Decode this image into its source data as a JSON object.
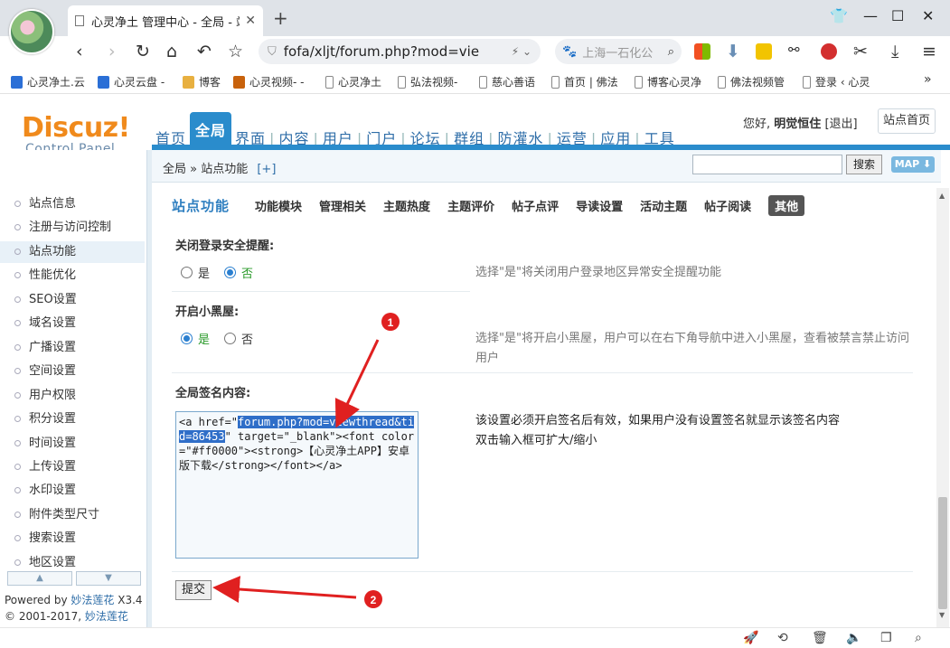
{
  "browser": {
    "tab_title": "心灵净土 管理中心 - 全局 - 站",
    "url": "fofa/xljt/forum.php?mod=vie",
    "search_placeholder": "上海一石化公",
    "bookmarks": [
      "心灵净土.云",
      "心灵云盘 -",
      "博客",
      "心灵视频- -",
      "心灵净土",
      "弘法视频-",
      "慈心善语",
      "首页 | 佛法",
      "博客心灵净",
      "佛法视频管",
      "登录 ‹ 心灵"
    ],
    "bookmarks_more": "»"
  },
  "header": {
    "logo": "Discuz!",
    "logo_sub": "Control Panel",
    "nav": [
      "首页",
      "全局",
      "界面",
      "内容",
      "用户",
      "门户",
      "论坛",
      "群组",
      "防灌水",
      "运营",
      "应用",
      "工具"
    ],
    "hello_prefix": "您好,",
    "username": "明觉恒住",
    "logout": "[退出]",
    "site_home": "站点首页",
    "breadcrumb": "全局 » 站点功能",
    "breadcrumb_plus": "[+]",
    "search_button": "搜索",
    "map_button": "MAP ⬇"
  },
  "sidebar": {
    "items": [
      "站点信息",
      "注册与访问控制",
      "站点功能",
      "性能优化",
      "SEO设置",
      "域名设置",
      "广播设置",
      "空间设置",
      "用户权限",
      "积分设置",
      "时间设置",
      "上传设置",
      "水印设置",
      "附件类型尺寸",
      "搜索设置",
      "地区设置"
    ],
    "arrow_up": "▲",
    "arrow_down": "▼",
    "powered_prefix": "Powered by",
    "powered_link": "妙法莲花",
    "powered_ver": "X3.4",
    "copyright_prefix": "© 2001-2017,",
    "copyright_link": "妙法莲花"
  },
  "content": {
    "section_title": "站点功能",
    "tabs": [
      "功能模块",
      "管理相关",
      "主题热度",
      "主题评价",
      "帖子点评",
      "导读设置",
      "活动主题",
      "帖子阅读",
      "其他"
    ],
    "field1": {
      "label": "关闭登录安全提醒:",
      "opt_yes": "是",
      "opt_no": "否",
      "tip": "选择\"是\"将关闭用户登录地区异常安全提醒功能"
    },
    "field2": {
      "label": "开启小黑屋:",
      "opt_yes": "是",
      "opt_no": "否",
      "tip": "选择\"是\"将开启小黑屋，用户可以在右下角导航中进入小黑屋，查看被禁言禁止访问用户"
    },
    "field3": {
      "label": "全局签名内容:",
      "value_before": "<a href=\"",
      "value_selected": "forum.php?mod=viewthread&tid=86453",
      "value_after": "\" target=\"_blank\"><font color=\"#ff0000\"><strong>【心灵净土APP】安卓版下载</strong></font></a>",
      "tip1": "该设置必须开启签名后有效，如果用户没有设置签名就显示该签名内容",
      "tip2": "双击输入框可扩大/缩小"
    },
    "submit": "提交"
  },
  "annotations": {
    "marker1": "1",
    "marker2": "2",
    "color": "#e02020"
  }
}
